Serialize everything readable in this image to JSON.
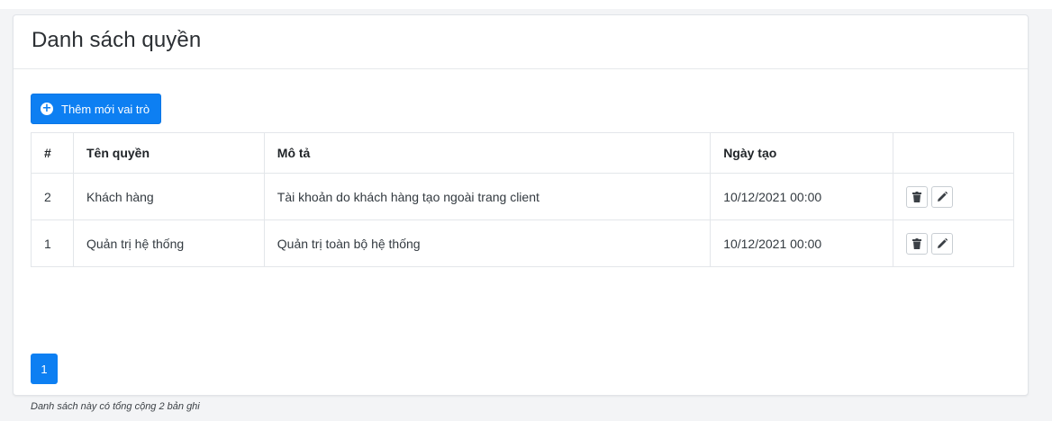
{
  "header": {
    "title": "Danh sách quyền"
  },
  "toolbar": {
    "add_label": "Thêm mới vai trò",
    "add_icon": "plus-circle-icon"
  },
  "table": {
    "columns": [
      "#",
      "Tên quyền",
      "Mô tả",
      "Ngày tạo",
      ""
    ],
    "rows": [
      {
        "index": "2",
        "name": "Khách hàng",
        "description": "Tài khoản do khách hàng tạo ngoài trang client",
        "created": "10/12/2021 00:00"
      },
      {
        "index": "1",
        "name": "Quản trị hệ thống",
        "description": "Quản trị toàn bộ hệ thống",
        "created": "10/12/2021 00:00"
      }
    ],
    "row_actions": [
      "trash-icon",
      "pencil-icon"
    ]
  },
  "pagination": {
    "current_page": "1"
  },
  "footer": {
    "summary": "Danh sách này có tổng cộng 2 bản ghi"
  },
  "colors": {
    "accent": "#0d7ff2",
    "background": "#f3f4f6"
  }
}
